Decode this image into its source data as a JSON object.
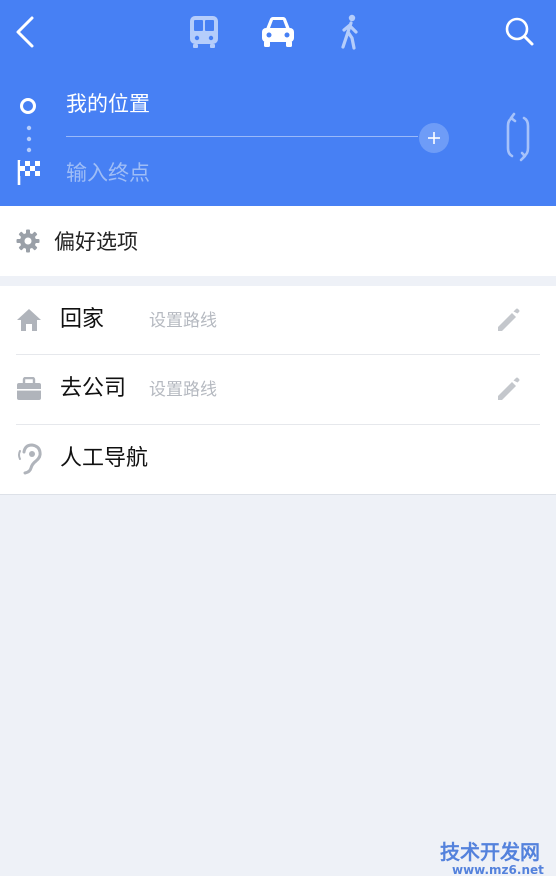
{
  "header": {
    "origin": "我的位置",
    "destination_placeholder": "输入终点",
    "modes": [
      "bus-icon",
      "car-icon",
      "walk-icon"
    ],
    "active_mode": "car-icon",
    "accent_color": "#4780f4"
  },
  "preferences": {
    "label": "偏好选项"
  },
  "shortcuts": [
    {
      "title": "回家",
      "subtitle": "设置路线",
      "icon": "home-icon"
    },
    {
      "title": "去公司",
      "subtitle": "设置路线",
      "icon": "briefcase-icon"
    },
    {
      "title": "人工导航",
      "icon": "ear-icon"
    }
  ],
  "watermark": {
    "title": "技术开发网",
    "url": "www.mz6.net"
  }
}
